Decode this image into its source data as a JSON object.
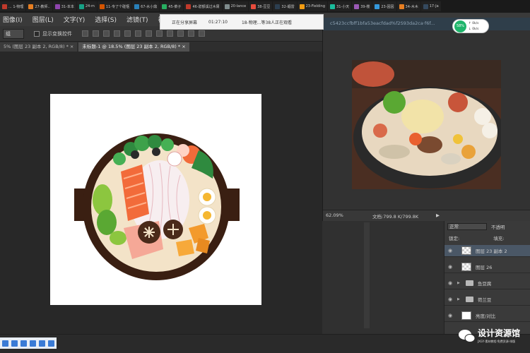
{
  "taskbar": {
    "items": [
      {
        "label": "... 1-物理",
        "color": "#c0392b"
      },
      {
        "label": "27-教师..",
        "color": "#e67e22"
      },
      {
        "label": "31-本本",
        "color": "#8e44ad"
      },
      {
        "label": "24-m",
        "color": "#16a085"
      },
      {
        "label": "11-专了个碰惬",
        "color": "#d35400"
      },
      {
        "label": "67-水小鼎",
        "color": "#2980b9"
      },
      {
        "label": "45-菜子",
        "color": "#27ae60"
      },
      {
        "label": "46-碧额溪过木屑",
        "color": "#c0392b"
      },
      {
        "label": "20-lance",
        "color": "#7f8c8d"
      },
      {
        "label": "38-豆豆",
        "color": "#e74c3c"
      },
      {
        "label": "32-緾雷",
        "color": "#2c3e50"
      },
      {
        "label": "23-Fielding",
        "color": "#f39c12"
      },
      {
        "label": "31-小天",
        "color": "#1abc9c"
      },
      {
        "label": "39-楼",
        "color": "#9b59b6"
      },
      {
        "label": "23-因因",
        "color": "#3498db"
      },
      {
        "label": "34-木木",
        "color": "#e67e22"
      },
      {
        "label": "17-Ja",
        "color": "#34495e"
      }
    ]
  },
  "menubar": {
    "items": [
      "图像(I)",
      "图层(L)",
      "文字(Y)",
      "选择(S)",
      "滤镜(T)",
      "视图(V)"
    ]
  },
  "share": {
    "label": "正在分享屏幕",
    "time": "01:27:10",
    "viewers": "18-物理...等38人正在观看"
  },
  "options": {
    "select_value": "组",
    "checkbox_label": "显示变换控件"
  },
  "tabs": {
    "items": [
      {
        "label": "5% (图层 23 副本 2, RGB/8) * ×",
        "active": false
      },
      {
        "label": "未标题-1 @ 18.5% (图层 23 副本 2, RGB/8) * ×",
        "active": true
      }
    ]
  },
  "refwin": {
    "title": "c5423ccfbff1bfa53eacfdad%f2S93da2ca·f6f...",
    "zoom": "62.09%",
    "doc_info": "文档:799.8 K/799.8K"
  },
  "speed": {
    "percent": "58%",
    "up": "↑ 0k/s",
    "down": "↓ 0k/s"
  },
  "layers": {
    "mode": "正常",
    "opacity_label": "不透明",
    "lock_label": "锁定:",
    "fill_label": "填充:",
    "rows": [
      {
        "type": "layer",
        "name": "图层 23 副本 2",
        "selected": true
      },
      {
        "type": "layer",
        "name": "图层 26",
        "selected": false
      },
      {
        "type": "folder",
        "name": "鱼豆腐"
      },
      {
        "type": "folder",
        "name": "荷兰豆"
      },
      {
        "type": "adjust",
        "name": "亮度/对比"
      }
    ]
  },
  "watermark": {
    "title": "设计资源馆",
    "subtitle": "JXGY·素材教程·免费资源·排版"
  },
  "colors": {
    "pot": "#3a1f12",
    "broth": "#f3e3c8",
    "accent_share": "#f4f4f4",
    "speed_green": "#1fb56b"
  }
}
